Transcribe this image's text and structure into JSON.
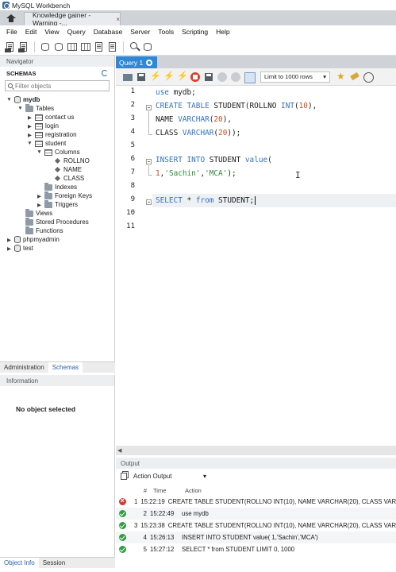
{
  "window": {
    "title": "MySQL Workbench"
  },
  "tabs": {
    "connection_tab": "Knowledge gainer - Warning -...",
    "close": "×"
  },
  "menu": [
    "File",
    "Edit",
    "View",
    "Query",
    "Database",
    "Server",
    "Tools",
    "Scripting",
    "Help"
  ],
  "navigator": {
    "header": "Navigator",
    "schemas_label": "SCHEMAS",
    "filter_placeholder": "Filter objects",
    "tree": {
      "mydb": "mydb",
      "tables": "Tables",
      "t1": "contact us",
      "t2": "login",
      "t3": "registration",
      "t4": "student",
      "columns": "Columns",
      "c1": "ROLLNO",
      "c2": "NAME",
      "c3": "CLASS",
      "indexes": "Indexes",
      "fks": "Foreign Keys",
      "triggers": "Triggers",
      "views": "Views",
      "procs": "Stored Procedures",
      "funcs": "Functions",
      "phpmyadmin": "phpmyadmin",
      "test": "test"
    },
    "tab_admin": "Administration",
    "tab_schemas": "Schemas"
  },
  "information": {
    "header": "Information",
    "body": "No object selected",
    "tab_object_info": "Object Info",
    "tab_session": "Session"
  },
  "editor": {
    "tab_label": "Query 1",
    "limit_label": "Limit to 1000 rows",
    "line_numbers": [
      "1",
      "2",
      "3",
      "4",
      "5",
      "6",
      "7",
      "8",
      "9",
      "10",
      "11"
    ],
    "l1": {
      "kw": "use",
      "rest": " mydb;"
    },
    "l2": {
      "kw1": "CREATE TABLE",
      "a": " STUDENT(ROLLNO ",
      "ty": "INT",
      "p1": "(",
      "n": "10",
      "p2": "),"
    },
    "l3": {
      "a": "NAME ",
      "ty": "VARCHAR",
      "p1": "(",
      "n": "20",
      "p2": "),"
    },
    "l4": {
      "a": "CLASS ",
      "ty": "VARCHAR",
      "p1": "(",
      "n": "20",
      "p2": "));"
    },
    "l6": {
      "kw": "INSERT INTO",
      "a": " STUDENT ",
      "kw2": "value",
      "p": "("
    },
    "l7": {
      "n": "1",
      "c1": ",",
      "s1": "'Sachin'",
      "c2": ",",
      "s2": "'MCA'",
      "e": ");"
    },
    "l9": {
      "kw": "SELECT",
      "a": " * ",
      "kw2": "from",
      "b": " STUDENT;"
    }
  },
  "output": {
    "header": "Output",
    "selector": "Action Output",
    "col_num": "#",
    "col_time": "Time",
    "col_action": "Action",
    "rows": [
      {
        "status": "error",
        "n": "1",
        "time": "15:22:19",
        "action": "CREATE TABLE STUDENT(ROLLNO INT(10), NAME VARCHAR(20), CLASS VAR"
      },
      {
        "status": "ok",
        "n": "2",
        "time": "15:22:49",
        "action": "use mydb"
      },
      {
        "status": "ok",
        "n": "3",
        "time": "15:23:38",
        "action": "CREATE TABLE STUDENT(ROLLNO INT(10), NAME VARCHAR(20), CLASS VAR"
      },
      {
        "status": "ok",
        "n": "4",
        "time": "15:26:13",
        "action": "INSERT INTO STUDENT value( 1,'Sachin','MCA')"
      },
      {
        "status": "ok",
        "n": "5",
        "time": "15:27:12",
        "action": "SELECT * from STUDENT LIMIT 0, 1000"
      }
    ]
  },
  "colors": {
    "accent": "#2f87d6",
    "keyword": "#3272c2",
    "string": "#2f8b3a",
    "number": "#c4511e",
    "ok": "#2f9d3e",
    "error": "#d93a2e"
  }
}
